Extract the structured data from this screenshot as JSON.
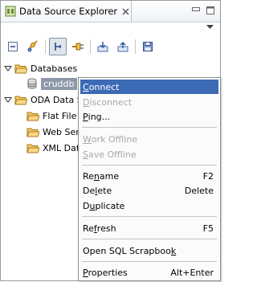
{
  "view": {
    "title": "Data Source Explorer"
  },
  "tree": {
    "databases": "Databases",
    "cruddb": "cruddb",
    "oda": "ODA Data So",
    "flat_file": "Flat File D",
    "web_service": "Web Servi",
    "xml_data": "XML Data"
  },
  "context_menu": {
    "items": [
      {
        "pre": "",
        "mn": "C",
        "post": "onnect",
        "accel": ""
      },
      {
        "pre": "",
        "mn": "D",
        "post": "isconnect",
        "accel": ""
      },
      {
        "pre": "",
        "mn": "P",
        "post": "ing...",
        "accel": ""
      },
      {
        "pre": "",
        "mn": "W",
        "post": "ork Offline",
        "accel": ""
      },
      {
        "pre": "",
        "mn": "S",
        "post": "ave Offline",
        "accel": ""
      },
      {
        "pre": "Re",
        "mn": "n",
        "post": "ame",
        "accel": "F2"
      },
      {
        "pre": "De",
        "mn": "l",
        "post": "ete",
        "accel": "Delete"
      },
      {
        "pre": "D",
        "mn": "u",
        "post": "plicate",
        "accel": ""
      },
      {
        "pre": "Re",
        "mn": "f",
        "post": "resh",
        "accel": "F5"
      },
      {
        "pre": "Open SQL Scrapboo",
        "mn": "k",
        "post": "",
        "accel": ""
      },
      {
        "pre": "",
        "mn": "P",
        "post": "roperties",
        "accel": "Alt+Enter"
      }
    ]
  },
  "colors": {
    "selection": "#3d6ab5",
    "tree_selection": "#8d99a8",
    "disabled_text": "#a8a8a8"
  }
}
